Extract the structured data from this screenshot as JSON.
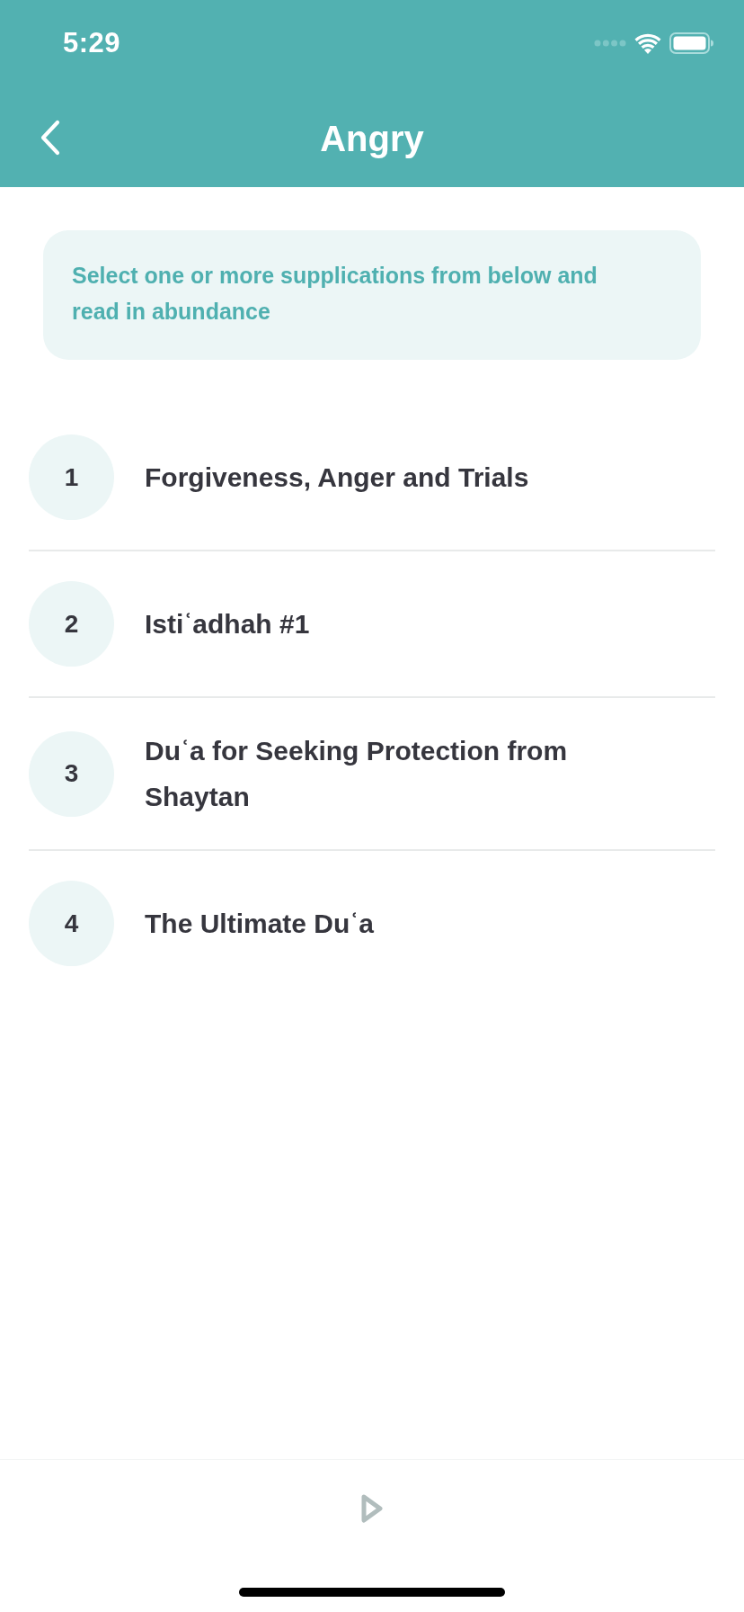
{
  "status_bar": {
    "time": "5:29"
  },
  "header": {
    "title": "Angry"
  },
  "banner": {
    "text": "Select one or more supplications from below and read in abundance"
  },
  "supplications": [
    {
      "number": "1",
      "title": "Forgiveness, Anger and Trials"
    },
    {
      "number": "2",
      "title": "Istiʿadhah #1"
    },
    {
      "number": "3",
      "title": "Duʿa for Seeking Protection from Shaytan"
    },
    {
      "number": "4",
      "title": "The Ultimate Duʿa"
    }
  ]
}
